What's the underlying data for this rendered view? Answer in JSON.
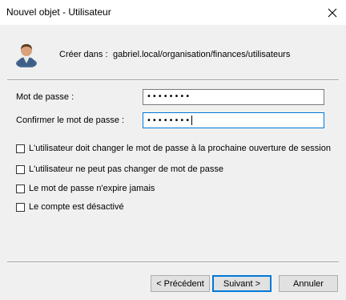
{
  "window": {
    "title": "Nouvel objet - Utilisateur",
    "close_icon": "close-icon"
  },
  "header": {
    "icon": "user-icon",
    "create_in_label": "Créer dans :",
    "create_in_path": "gabriel.local/organisation/finances/utilisateurs"
  },
  "form": {
    "password_label": "Mot de passe :",
    "password_value": "••••••••",
    "confirm_label": "Confirmer le mot de passe :",
    "confirm_value": "••••••••"
  },
  "options": [
    {
      "label": "L'utilisateur doit changer le mot de passe à la prochaine ouverture de session",
      "checked": false
    },
    {
      "label": "L'utilisateur ne peut pas changer de mot de passe",
      "checked": false
    },
    {
      "label": "Le mot de passe n'expire jamais",
      "checked": false
    },
    {
      "label": "Le compte est désactivé",
      "checked": false
    }
  ],
  "buttons": {
    "previous": "< Précédent",
    "next": "Suivant >",
    "cancel": "Annuler"
  },
  "colors": {
    "accent": "#0078d7",
    "background": "#f0f0f0"
  }
}
